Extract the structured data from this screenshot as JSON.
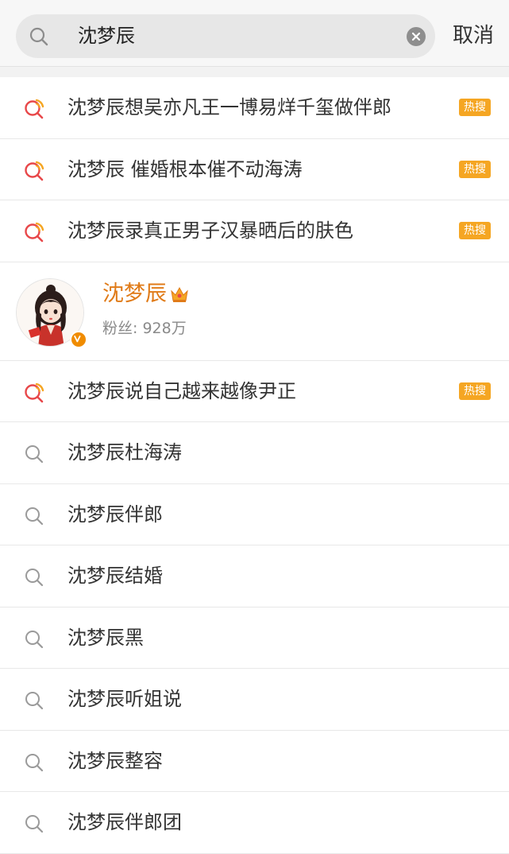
{
  "search": {
    "query": "沈梦辰",
    "cancel_label": "取消"
  },
  "hot_badge": "热搜",
  "suggestions_top": [
    {
      "label": "沈梦辰想吴亦凡王一博易烊千玺做伴郎",
      "hot": true
    },
    {
      "label": "沈梦辰 催婚根本催不动海涛",
      "hot": true
    },
    {
      "label": "沈梦辰录真正男子汉暴晒后的肤色",
      "hot": true
    }
  ],
  "user_card": {
    "name": "沈梦辰",
    "fans_label": "粉丝:",
    "fans_count": "928万"
  },
  "suggestions_bottom": [
    {
      "label": "沈梦辰说自己越来越像尹正",
      "hot": true
    },
    {
      "label": "沈梦辰杜海涛",
      "hot": false
    },
    {
      "label": "沈梦辰伴郎",
      "hot": false
    },
    {
      "label": "沈梦辰结婚",
      "hot": false
    },
    {
      "label": "沈梦辰黑",
      "hot": false
    },
    {
      "label": "沈梦辰听姐说",
      "hot": false
    },
    {
      "label": "沈梦辰整容",
      "hot": false
    },
    {
      "label": "沈梦辰伴郎团",
      "hot": false
    }
  ],
  "colors": {
    "accent_orange": "#f5a623",
    "username_orange": "#e07b18",
    "hot_icon_red": "#e8484a"
  }
}
